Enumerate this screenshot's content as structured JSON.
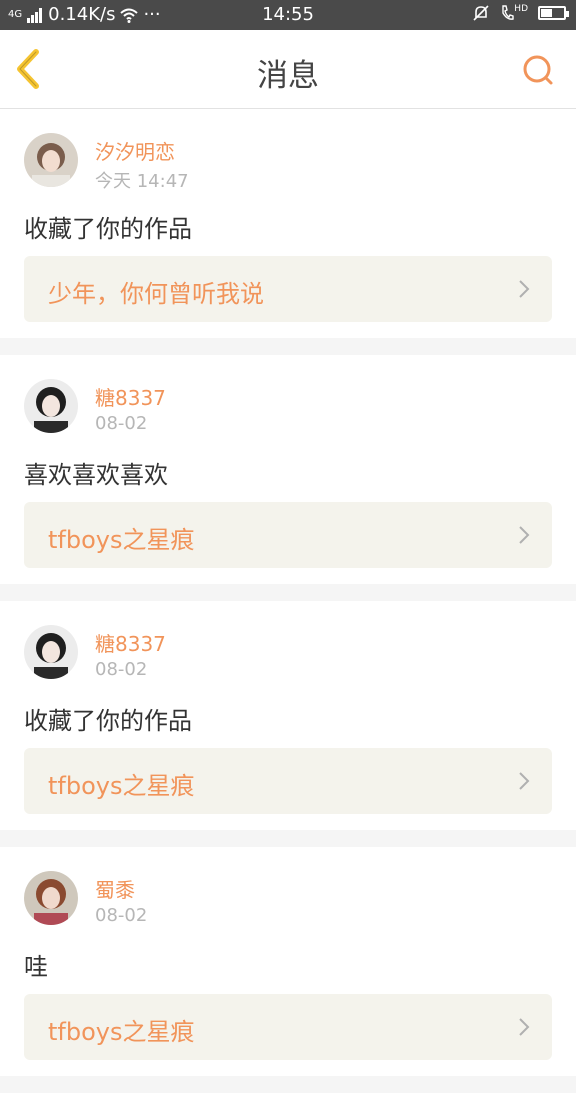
{
  "statusbar": {
    "network": "4G",
    "speed": "0.14K/s",
    "more": "···",
    "time": "14:55",
    "hd": "HD"
  },
  "header": {
    "title": "消息"
  },
  "colors": {
    "accent": "#f1945a",
    "back_icon": "#f5c431",
    "card_bg": "#ffffff",
    "work_bg": "#f4f3ec"
  },
  "messages": [
    {
      "user": "汐汐明恋",
      "time": "今天 14:47",
      "text": "收藏了你的作品",
      "work": "少年，你何曾听我说"
    },
    {
      "user": "糖8337",
      "time": "08-02",
      "text": "喜欢喜欢喜欢",
      "work": "tfboys之星痕"
    },
    {
      "user": "糖8337",
      "time": "08-02",
      "text": "收藏了你的作品",
      "work": "tfboys之星痕"
    },
    {
      "user": "蜀黍",
      "time": "08-02",
      "text": "哇",
      "work": "tfboys之星痕"
    }
  ]
}
